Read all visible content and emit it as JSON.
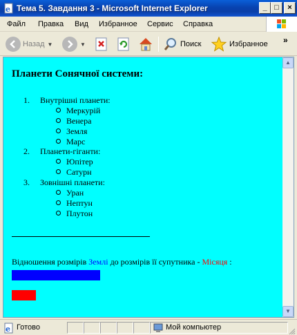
{
  "window": {
    "title": "Тема 5. Завдання 3 - Microsoft Internet Explorer",
    "minimize": "_",
    "maximize": "□",
    "close": "×"
  },
  "menu": [
    "Файл",
    "Правка",
    "Вид",
    "Избранное",
    "Сервис",
    "Справка"
  ],
  "toolbar": {
    "back_label": "Назад",
    "search_label": "Поиск",
    "favorites_label": "Избранное",
    "more": "»"
  },
  "page": {
    "heading": "Планети Сонячної системи:",
    "groups": [
      {
        "num": "1.",
        "label": "Внутрішні планети:",
        "items": [
          "Меркурій",
          "Венера",
          "Земля",
          "Марс"
        ]
      },
      {
        "num": "2.",
        "label": "Планети-гіганти:",
        "items": [
          "Юпітер",
          "Сатурн"
        ]
      },
      {
        "num": "3.",
        "label": "Зовнішні планети:",
        "items": [
          "Уран",
          "Нептун",
          "Плутон"
        ]
      }
    ],
    "ratio_prefix": "Відношення розмірів ",
    "ratio_earth": "Землі",
    "ratio_middle": " до розмірів її супутника - ",
    "ratio_moon": "Місяця",
    "ratio_suffix": " :",
    "earth_color": "#0000ff",
    "moon_color": "#ff0000",
    "background": "#00ffff"
  },
  "status": {
    "ready": "Готово",
    "zone": "Мой компьютер"
  }
}
